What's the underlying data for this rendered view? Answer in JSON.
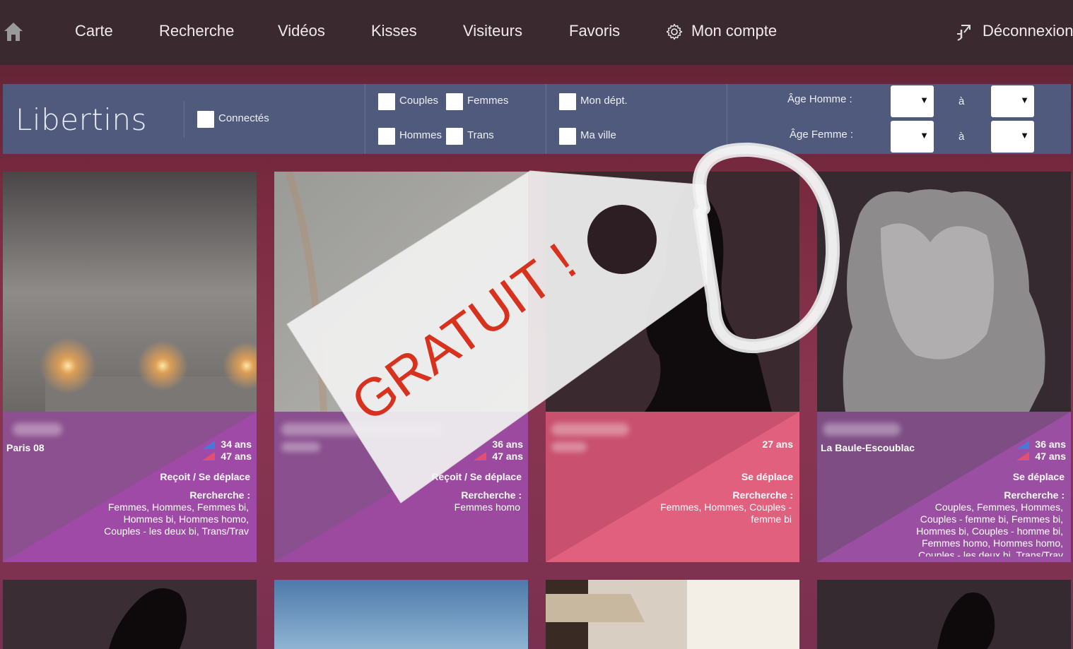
{
  "nav": {
    "items": [
      "Carte",
      "Recherche",
      "Vidéos",
      "Kisses",
      "Visiteurs",
      "Favoris"
    ],
    "account": "Mon compte",
    "logout": "Déconnexion"
  },
  "filters": {
    "title": "Libertins",
    "connected": "Connectés",
    "couples": "Couples",
    "femmes": "Femmes",
    "hommes": "Hommes",
    "trans": "Trans",
    "dept": "Mon dépt.",
    "ville": "Ma ville",
    "age_homme": "Âge Homme :",
    "age_femme": "Âge Femme :",
    "a": "à"
  },
  "cards": [
    {
      "city": "Paris 08",
      "age1": "34 ans",
      "age2": "47 ans",
      "mode": "Reçoit / Se déplace",
      "search_label": "Rercherche :",
      "search": [
        "Femmes, Hommes, Femmes bi,",
        "Hommes bi, Hommes homo,",
        "Couples - les deux bi, Trans/Trav"
      ]
    },
    {
      "city": "",
      "age1": "36 ans",
      "age2": "47 ans",
      "mode": "Reçoit / Se déplace",
      "search_label": "Rercherche :",
      "search": [
        "Femmes homo"
      ]
    },
    {
      "city": "",
      "age1": "27 ans",
      "age2": "",
      "mode": "Se déplace",
      "search_label": "Rercherche :",
      "search": [
        "Femmes, Hommes, Couples -",
        "femme bi"
      ]
    },
    {
      "city": "La Baule-Escoublac",
      "age1": "36 ans",
      "age2": "47 ans",
      "mode": "Se déplace",
      "search_label": "Rercherche :",
      "search": [
        "Couples, Femmes, Hommes,",
        "Couples - femme bi, Femmes bi,",
        "Hommes bi, Couples - homme bi,",
        "Femmes homo, Hommes homo,",
        "Couples - les deux bi, Trans/Trav"
      ]
    }
  ],
  "tag": {
    "text": "GRATUIT !"
  },
  "colors": {
    "topnav": "#3a2a30",
    "filterbar": "#4f5a7c",
    "card_purple": "#9b4fa3",
    "card_pink": "#e0607e",
    "tag_text": "#d8321e"
  }
}
